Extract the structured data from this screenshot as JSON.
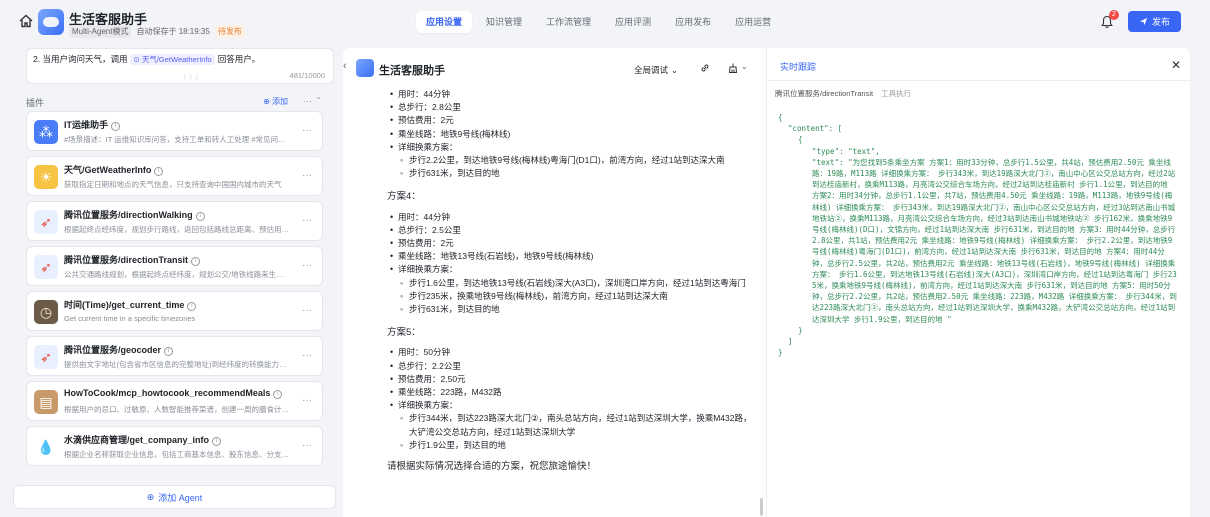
{
  "app": {
    "name": "生活客服助手",
    "mode": "Multi-Agent模式",
    "autosave": "自动保存于 18:19:35",
    "status": "待发布"
  },
  "tabs": [
    {
      "label": "应用设置",
      "active": true
    },
    {
      "label": "知识管理",
      "active": false
    },
    {
      "label": "工作流管理",
      "active": false
    },
    {
      "label": "应用评测",
      "active": false
    },
    {
      "label": "应用发布",
      "active": false
    },
    {
      "label": "应用运营",
      "active": false
    }
  ],
  "notifications": {
    "count": "2"
  },
  "publish_label": "发布",
  "prompt": {
    "text_before": "2. 当用户询问天气，调用",
    "chip": "天气/GetWeatherInfo",
    "text_after": "回答用户。",
    "count": "481/10000"
  },
  "plugins": {
    "title": "插件",
    "add_label": "添加",
    "items": [
      {
        "name": "IT运维助手",
        "desc": "#场景描述：IT 运维知识库问答，支持工单和转人工处理 #常见问…",
        "icon": "cluster-icon",
        "color": "#4a7cf7"
      },
      {
        "name": "天气/GetWeatherInfo",
        "desc": "获取指定日期和地点的天气信息，只支持查询中国国内城市的天气",
        "icon": "sun-icon",
        "color": "#f6c343"
      },
      {
        "name": "腾讯位置服务/directionWalking",
        "desc": "根据起终点经纬度，规划步行路线，返回包括路线总距离、预估用…",
        "icon": "compass-icon",
        "color": "#e8f0ff"
      },
      {
        "name": "腾讯位置服务/directionTransit",
        "desc": "公共交通路线规划，根据起终点经纬度，规划公交/地铁线路来生…",
        "icon": "compass-icon",
        "color": "#e8f0ff"
      },
      {
        "name": "时间(Time)/get_current_time",
        "desc": "Get current time in a specific timezones",
        "icon": "clock-icon",
        "color": "#6b5a48"
      },
      {
        "name": "腾讯位置服务/geocoder",
        "desc": "提供由文字地址(包含省市区信息的完整地址)到经纬度的转换能力…",
        "icon": "compass-icon",
        "color": "#e8f0ff"
      },
      {
        "name": "HowToCook/mcp_howtocook_recommendMeals",
        "desc": "根据用户的忌口、过敏原、人数智能推荐菜谱，创建一周的膳食计…",
        "icon": "cookbook-icon",
        "color": "#c89a6a"
      },
      {
        "name": "水滴供应商管理/get_company_info",
        "desc": "根据企业名称获取企业信息，包括工商基本信息、股东信息、分支…",
        "icon": "water-drop-icon",
        "color": "#ffffff"
      }
    ]
  },
  "add_agent_label": "添加 Agent",
  "chat": {
    "title": "生活客服助手",
    "debug_label": "全局调试",
    "plan3_items": [
      {
        "text": "用时：44分钟",
        "sub": false
      },
      {
        "text": "总步行：2.8公里",
        "sub": false
      },
      {
        "text": "预估费用：2元",
        "sub": false
      },
      {
        "text": "乘坐线路：地铁9号线(梅林线)",
        "sub": false
      },
      {
        "text": "详细换乘方案：",
        "sub": false
      },
      {
        "text": "步行2.2公里，到达地铁9号线(梅林线)粤海门(D1口)，前湾方向，经过1站到达深大南",
        "sub": true
      },
      {
        "text": "步行631米，到达目的地",
        "sub": true
      }
    ],
    "plan4_title": "方案4：",
    "plan4_items": [
      {
        "text": "用时：44分钟",
        "sub": false
      },
      {
        "text": "总步行：2.5公里",
        "sub": false
      },
      {
        "text": "预估费用：2元",
        "sub": false
      },
      {
        "text": "乘坐线路：地铁13号线(石岩线)，地铁9号线(梅林线)",
        "sub": false
      },
      {
        "text": "详细换乘方案：",
        "sub": false
      },
      {
        "text": "步行1.6公里，到达地铁13号线(石岩线)深大(A3口)，深圳湾口岸方向，经过1站到达粤海门",
        "sub": true
      },
      {
        "text": "步行235米，换乘地铁9号线(梅林线)，前湾方向，经过1站到达深大南",
        "sub": true
      },
      {
        "text": "步行631米，到达目的地",
        "sub": true
      }
    ],
    "plan5_title": "方案5：",
    "plan5_items": [
      {
        "text": "用时：50分钟",
        "sub": false
      },
      {
        "text": "总步行：2.2公里",
        "sub": false
      },
      {
        "text": "预估费用：2.50元",
        "sub": false
      },
      {
        "text": "乘坐线路：223路，M432路",
        "sub": false
      },
      {
        "text": "详细换乘方案：",
        "sub": false
      },
      {
        "text": "步行344米，到达223路深大北门②，南头总站方向，经过1站到达深圳大学，换乘M432路，大铲湾公交总站方向，经过1站到达深圳大学",
        "sub": true
      },
      {
        "text": "步行1.9公里，到达目的地",
        "sub": true
      }
    ],
    "closing": "请根据实际情况选择合适的方案，祝您旅途愉快！"
  },
  "trace": {
    "title": "实时跟踪",
    "tool": "腾讯位置服务/directionTransit",
    "exec_label": "工具执行",
    "json_open": "{",
    "content_key": "\"content\": [",
    "item_open": "{",
    "type_line": "\"type\": \"text\",",
    "text_key": "\"text\": ",
    "text_value": "\"为您找到5条乘坐方案 方案1：用时33分钟，总步行1.5公里，共4站，预估费用2.50元 乘坐线路：19路，M113路 详细换乘方案： 步行343米，到达19路深大北门②，南山中心区公交总站方向，经过2站到达桂庙新村，换乘M113路，月亮湾公交综合车场方向，经过2站到达桂庙新村 步行1.1公里，到达目的地 方案2：用时34分钟，总步行1.1公里，共7站，预估费用4.50元 乘坐线路：19路，M113路，地铁9号线(梅林线) 详细换乘方案： 步行343米，到达19路深大北门②，南山中心区公交总站方向，经过3站到达南山书城地铁站②，换乘M113路，月亮湾公交综合车场方向，经过3站到达南山书城地铁站② 步行162米，换乘地铁9号线(梅林线)(D口)，文锦方向，经过1站到达深大南 步行631米，到达目的地 方案3：用时44分钟，总步行2.8公里，共1站，预估费用2元 乘坐线路：地铁9号线(梅林线) 详细换乘方案： 步行2.2公里，到达地铁9号线(梅林线)粤海门(D1口)，前湾方向，经过1站到达深大南 步行631米，到达目的地 方案4：用时44分钟，总步行2.5公里，共2站，预估费用2元 乘坐线路：地铁13号线(石岩线)，地铁9号线(梅林线) 详细换乘方案： 步行1.6公里，到达地铁13号线(石岩线)深大(A3口)，深圳湾口岸方向，经过1站到达粤海门 步行235米，换乘地铁9号线(梅林线)，前湾方向，经过1站到达深大南 步行631米，到达目的地 方案5：用时50分钟，总步行2.2公里，共2站，预估费用2.50元 乘坐线路：223路，M432路 详细换乘方案： 步行344米，到达223路深大北门②，南头总站方向，经过1站到达深圳大学，换乘M432路，大铲湾公交总站方向，经过1站到达深圳大学 步行1.9公里，到达目的地 \"",
    "item_close": "}",
    "array_close": "]",
    "json_close": "}"
  }
}
